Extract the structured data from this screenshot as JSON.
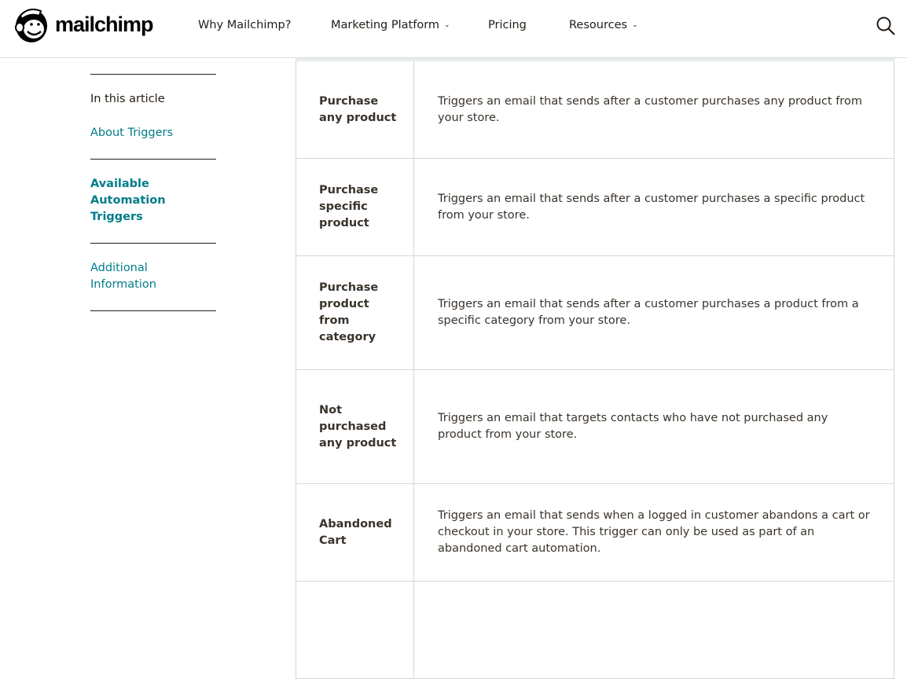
{
  "header": {
    "brand": "mailchimp",
    "nav": [
      {
        "label": "Why Mailchimp?",
        "dropdown": false
      },
      {
        "label": "Marketing Platform",
        "dropdown": true
      },
      {
        "label": "Pricing",
        "dropdown": false
      },
      {
        "label": "Resources",
        "dropdown": true
      }
    ],
    "search_icon": "search-icon"
  },
  "sidebar": {
    "title": "In this article",
    "items": [
      {
        "label": "About Triggers",
        "active": false
      },
      {
        "label": "Available Automation Triggers",
        "active": true
      },
      {
        "label": "Additional Information",
        "active": false
      }
    ]
  },
  "table": {
    "rows": [
      {
        "trigger": "Purchase any product",
        "description": "Triggers an email that sends after a customer purchases any product from your store."
      },
      {
        "trigger": "Purchase specific product",
        "description": "Triggers an email that sends after a customer purchases a specific product from your store."
      },
      {
        "trigger": "Purchase product from category",
        "description": "Triggers an email that sends after a customer purchases a product from a specific category from your store."
      },
      {
        "trigger": "Not purchased any product",
        "description": "Triggers an email that targets contacts who have not purchased any product from your store."
      },
      {
        "trigger": "Abandoned Cart",
        "description": "Triggers an email that sends when a logged in customer abandons a cart or checkout in your store. This trigger can only be used as part of an abandoned cart automation."
      },
      {
        "trigger": "",
        "description": ""
      }
    ]
  },
  "colors": {
    "link": "#007c89",
    "text": "#241c15",
    "border": "#d2d8d6"
  }
}
